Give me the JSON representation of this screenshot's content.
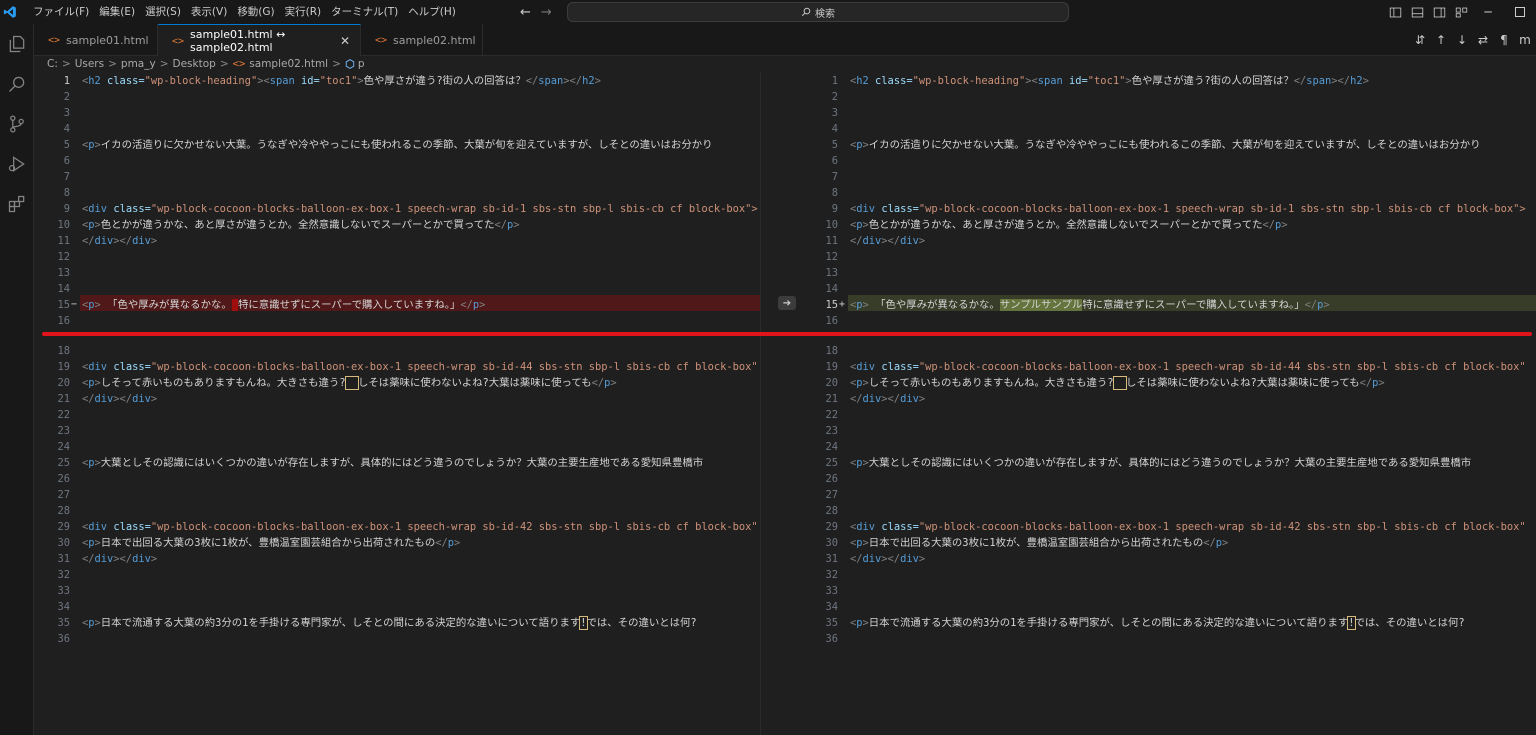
{
  "menu": [
    "ファイル(F)",
    "編集(E)",
    "選択(S)",
    "表示(V)",
    "移動(G)",
    "実行(R)",
    "ターミナル(T)",
    "ヘルプ(H)"
  ],
  "search": {
    "label": "検索"
  },
  "window": {
    "minimize": "─"
  },
  "tabs": [
    {
      "label": "sample01.html"
    },
    {
      "label": "sample01.html ↔ sample02.html",
      "active": true
    },
    {
      "label": "sample02.html"
    }
  ],
  "breadcrumb": [
    "C:",
    "Users",
    "pma_y",
    "Desktop",
    "sample02.html",
    "p"
  ],
  "editor_actions": [
    "⇵",
    "↑",
    "↓",
    "⇄",
    "¶",
    "m"
  ],
  "left_lines": [
    {
      "n": "1"
    },
    {
      "n": "2"
    },
    {
      "n": "3"
    },
    {
      "n": "4"
    },
    {
      "n": "5"
    },
    {
      "n": "6"
    },
    {
      "n": "7"
    },
    {
      "n": "8"
    },
    {
      "n": "9"
    },
    {
      "n": "10"
    },
    {
      "n": "11"
    },
    {
      "n": "12"
    },
    {
      "n": "13"
    },
    {
      "n": "14"
    },
    {
      "n": "15"
    },
    {
      "n": "16"
    },
    {
      "n": "18"
    },
    {
      "n": "19"
    },
    {
      "n": "20"
    },
    {
      "n": "21"
    },
    {
      "n": "22"
    },
    {
      "n": "23"
    },
    {
      "n": "24"
    },
    {
      "n": "25"
    },
    {
      "n": "26"
    },
    {
      "n": "27"
    },
    {
      "n": "28"
    },
    {
      "n": "29"
    },
    {
      "n": "30"
    },
    {
      "n": "31"
    },
    {
      "n": "32"
    },
    {
      "n": "33"
    },
    {
      "n": "34"
    },
    {
      "n": "35"
    },
    {
      "n": "36"
    }
  ],
  "right_lines": [
    {
      "n": "1"
    },
    {
      "n": "2"
    },
    {
      "n": "3"
    },
    {
      "n": "4"
    },
    {
      "n": "5"
    },
    {
      "n": "6"
    },
    {
      "n": "7"
    },
    {
      "n": "8"
    },
    {
      "n": "9"
    },
    {
      "n": "10"
    },
    {
      "n": "11"
    },
    {
      "n": "12"
    },
    {
      "n": "13"
    },
    {
      "n": "14"
    },
    {
      "n": "15"
    },
    {
      "n": "16"
    },
    {
      "n": "18"
    },
    {
      "n": "19"
    },
    {
      "n": "20"
    },
    {
      "n": "21"
    },
    {
      "n": "22"
    },
    {
      "n": "23"
    },
    {
      "n": "24"
    },
    {
      "n": "25"
    },
    {
      "n": "26"
    },
    {
      "n": "27"
    },
    {
      "n": "28"
    },
    {
      "n": "29"
    },
    {
      "n": "30"
    },
    {
      "n": "31"
    },
    {
      "n": "32"
    },
    {
      "n": "33"
    },
    {
      "n": "34"
    },
    {
      "n": "35"
    },
    {
      "n": "36"
    }
  ],
  "code": {
    "l1_attr1": "class=",
    "l1_val1": "\"wp-block-heading\"",
    "l1_attr2": "id=",
    "l1_val2": "\"toc1\"",
    "l1_text": "色や厚さが違う?街の人の回答は？",
    "l5_text": "イカの活造りに欠かせない大葉。うなぎや冷ややっこにも使われるこの季節、大葉が旬を迎えていますが、しそとの違いはお分かり",
    "div_attr": "class=",
    "l9_val": "\"wp-block-cocoon-blocks-balloon-ex-box-1 speech-wrap sb-id-1 sbs-stn sbp-l sbis-cb cf block-box\">",
    "l10_text": "色とかが違うかな、あと厚さが違うとか。全然意識しないでスーパーとかで買ってた",
    "l15_left_a": "「色や厚みが異なるかな。",
    "l15_left_b": "特に意識せずにスーパーで購入していますね。」",
    "l15_right_a": "「色や厚みが異なるかな。",
    "l15_right_ins": "サンプルサンプル",
    "l15_right_b": "特に意識せずにスーパーで購入していますね。」",
    "l19_val": "\"wp-block-cocoon-blocks-balloon-ex-box-1 speech-wrap sb-id-44 sbs-stn sbp-l sbis-cb cf block-box\"",
    "l20_a": "しそって赤いものもありますもんね。大きさも違う?",
    "l20_b": "しそは薬味に使わないよね?大葉は薬味に使っても",
    "l25_text": "大葉としその認識にはいくつかの違いが存在しますが、具体的にはどう違うのでしょうか？大葉の主要生産地である愛知県豊橋市",
    "l29_val": "\"wp-block-cocoon-blocks-balloon-ex-box-1 speech-wrap sb-id-42 sbs-stn sbp-l sbis-cb cf block-box\"",
    "l30_text": "日本で出回る大葉の3枚に1枚が、豊橋温室園芸組合から出荷されたもの",
    "l35_a": "日本で流通する大葉の約3分の1を手掛ける専門家が、しそとの間にある決定的な違いについて語ります",
    "l35_b": "では、その違いとは何?"
  },
  "colors": {
    "removed": "#ff0000",
    "added": "#9bb955",
    "annotation": "#e0141a",
    "accent": "#0078d4"
  }
}
